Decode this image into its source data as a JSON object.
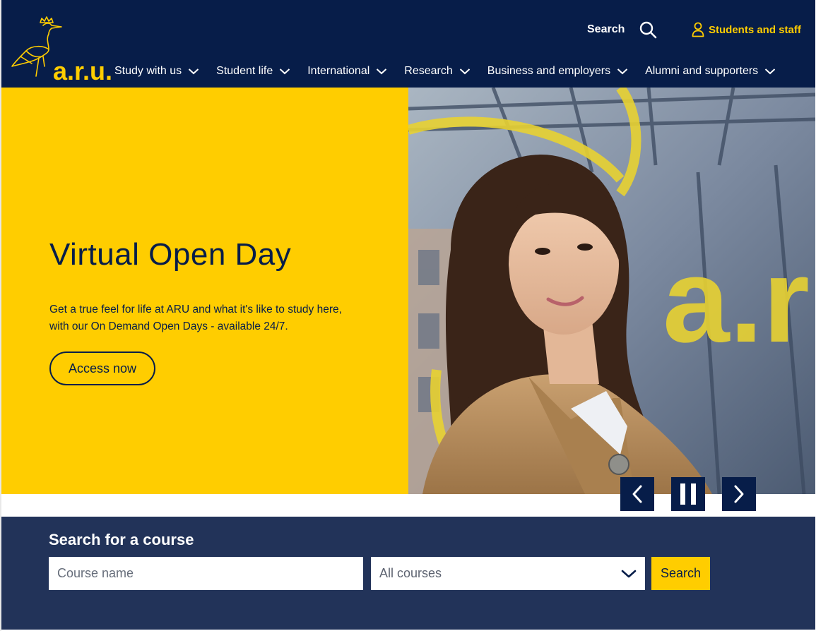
{
  "brand": {
    "logo_text": "a.r.u.",
    "navy": "#071d49",
    "yellow": "#ffcd00"
  },
  "utility": {
    "search_label": "Search",
    "search_icon": "search-icon",
    "students_label": "Students and staff",
    "students_icon": "user-icon"
  },
  "nav": {
    "items": [
      {
        "label": "Study with us"
      },
      {
        "label": "Student life"
      },
      {
        "label": "International"
      },
      {
        "label": "Research"
      },
      {
        "label": "Business and employers"
      },
      {
        "label": "Alumni and supporters"
      }
    ]
  },
  "hero": {
    "title": "Virtual Open Day",
    "text": "Get a true feel for life at ARU and what it's like to study here, with our On Demand Open Days - available 24/7.",
    "button_label": "Access now"
  },
  "carousel": {
    "prev_icon": "chevron-left-icon",
    "pause_icon": "pause-icon",
    "next_icon": "chevron-right-icon"
  },
  "course_search": {
    "title": "Search for a course",
    "input_placeholder": "Course name",
    "select_value": "All courses",
    "button_label": "Search"
  }
}
